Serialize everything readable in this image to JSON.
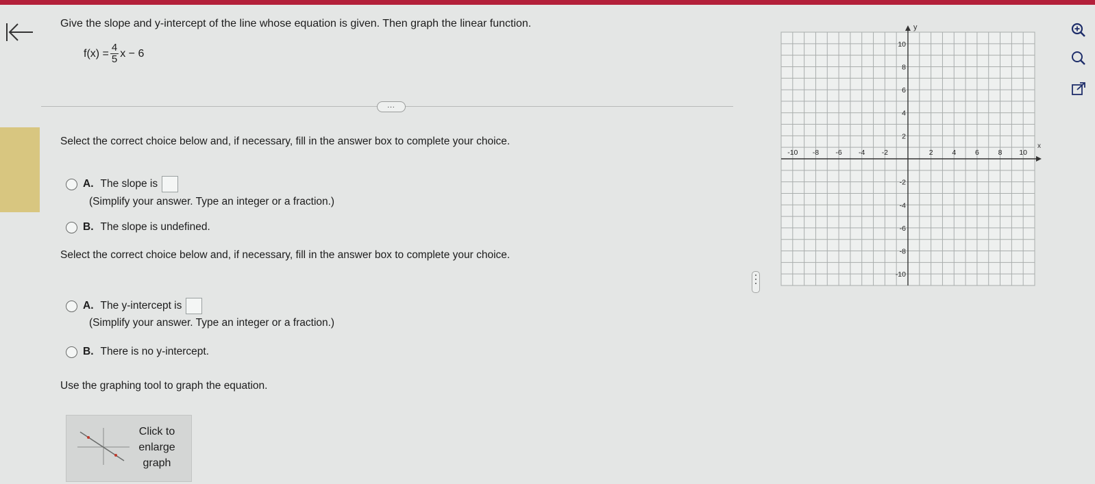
{
  "question": {
    "prompt": "Give the slope and y-intercept of the line whose equation is given. Then graph the linear function.",
    "equation": {
      "lhs": "f(x) =",
      "numerator": "4",
      "denominator": "5",
      "rhs": "x − 6"
    }
  },
  "expand_button": "...",
  "part_slope": {
    "instruction": "Select the correct choice below and, if necessary, fill in the answer box to complete your choice.",
    "choice_a": {
      "letter": "A.",
      "text": "The slope is",
      "hint": "(Simplify your answer. Type an integer or a fraction.)"
    },
    "choice_b": {
      "letter": "B.",
      "text": "The slope is undefined."
    }
  },
  "part_intercept": {
    "instruction": "Select the correct choice below and, if necessary, fill in the answer box to complete your choice.",
    "choice_a": {
      "letter": "A.",
      "text": "The y-intercept is",
      "hint": "(Simplify your answer. Type an integer or a fraction.)"
    },
    "choice_b": {
      "letter": "B.",
      "text": "There is no y-intercept."
    }
  },
  "graph_instruction": "Use the graphing tool to graph the equation.",
  "enlarge_button": {
    "line1": "Click to",
    "line2": "enlarge",
    "line3": "graph"
  },
  "graph": {
    "x_axis_label": "x",
    "y_axis_label": "y",
    "xlim": [
      -10,
      10
    ],
    "ylim": [
      -10,
      10
    ],
    "x_tick_labels": [
      "-10",
      "-8",
      "-6",
      "-4",
      "-2",
      "2",
      "4",
      "6",
      "8",
      "10"
    ],
    "y_tick_labels": [
      "10",
      "8",
      "6",
      "4",
      "2",
      "-2",
      "-4",
      "-6",
      "-8",
      "-10"
    ]
  },
  "tools": [
    "zoom-in-icon",
    "zoom-out-icon",
    "external-link-icon"
  ],
  "colors": {
    "top_bar": "#b3203a",
    "accent": "#d8c680"
  }
}
